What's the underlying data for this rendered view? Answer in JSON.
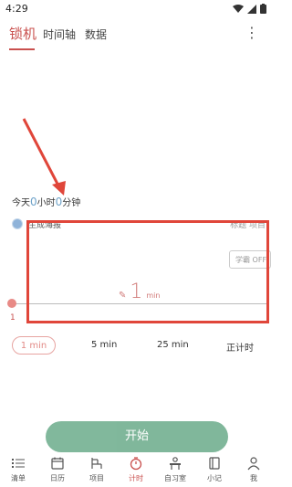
{
  "status_bar": {
    "time": "4:29"
  },
  "top_tabs": [
    {
      "label": "锁机",
      "active": true
    },
    {
      "label": "时间轴",
      "active": false
    },
    {
      "label": "数据",
      "active": false
    }
  ],
  "more_icon": "more-vertical-icon",
  "today": {
    "prefix": "今天",
    "hours": "0",
    "hours_unit": "小时",
    "minutes": "0",
    "minutes_unit": "分钟"
  },
  "poster": {
    "title": "生成海报",
    "right_text": "标题   项目"
  },
  "xueba_toggle": "学霸 OFF",
  "timer": {
    "value": "1",
    "unit": "min"
  },
  "slider": {
    "value_label": "1"
  },
  "presets": [
    {
      "label": "1 min",
      "selected": true
    },
    {
      "label": "5 min",
      "selected": false
    },
    {
      "label": "25 min",
      "selected": false
    },
    {
      "label": "正计时",
      "selected": false
    }
  ],
  "start_button": "开始",
  "bottom_nav": [
    {
      "label": "清单",
      "icon": "list-icon",
      "active": false
    },
    {
      "label": "日历",
      "icon": "calendar-icon",
      "active": false
    },
    {
      "label": "项目",
      "icon": "project-icon",
      "active": false
    },
    {
      "label": "计时",
      "icon": "timer-icon",
      "active": true
    },
    {
      "label": "自习室",
      "icon": "study-room-icon",
      "active": false
    },
    {
      "label": "小记",
      "icon": "notebook-icon",
      "active": false
    },
    {
      "label": "我",
      "icon": "profile-icon",
      "active": false
    }
  ],
  "colors": {
    "accent": "#c9504e",
    "annotation_red": "#e0463a",
    "start_button": "#73b091",
    "today_numbers": "#6fa3c9"
  }
}
